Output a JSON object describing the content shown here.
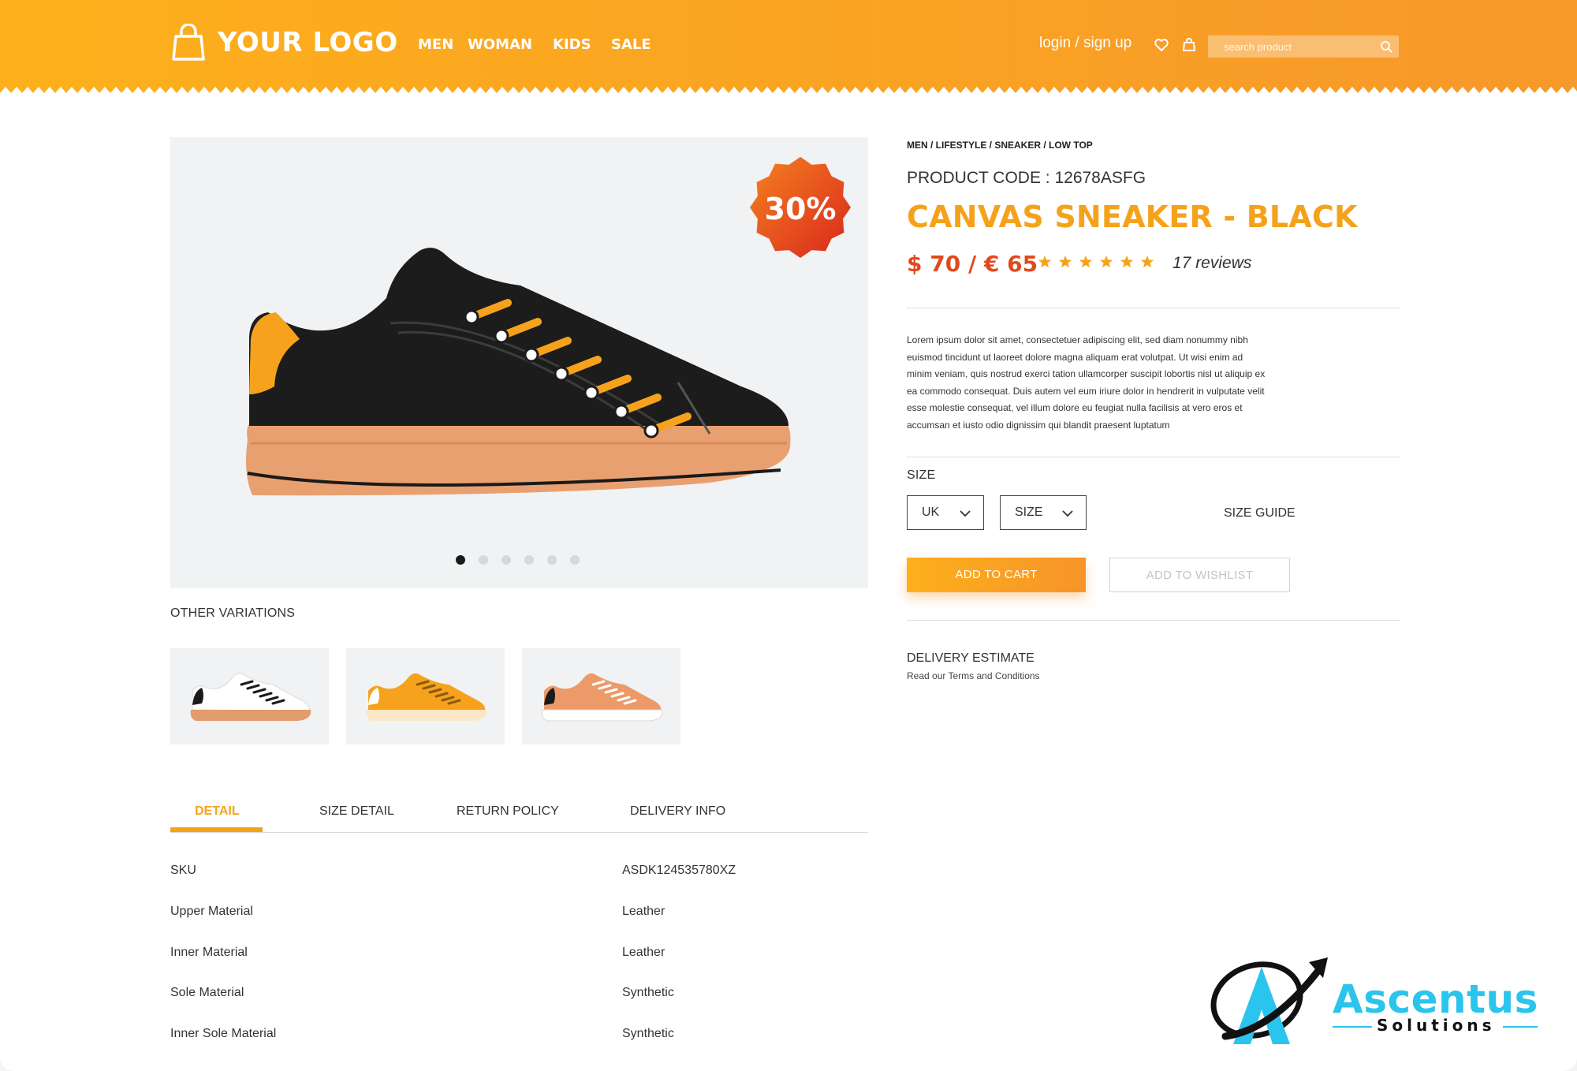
{
  "header": {
    "logo_text": "YOUR LOGO",
    "nav": [
      "MEN",
      "WOMAN",
      "KIDS",
      "SALE"
    ],
    "login": "login / sign up",
    "search_placeholder": "search product"
  },
  "gallery": {
    "discount": "30%",
    "slide_count": 6,
    "active_slide": 1
  },
  "variations": {
    "label": "OTHER VARIATIONS",
    "items": [
      "white",
      "orange",
      "peach"
    ]
  },
  "product": {
    "breadcrumb": "MEN / LIFESTYLE / SNEAKER / LOW TOP",
    "code": "PRODUCT CODE : 12678ASFG",
    "title": "CANVAS SNEAKER - BLACK",
    "price": "$ 70 / € 65",
    "rating": 6,
    "reviews": "17 reviews",
    "description": "Lorem ipsum dolor sit amet, consectetuer adipiscing elit, sed diam nonummy nibh euismod tincidunt ut laoreet dolore magna aliquam erat volutpat. Ut wisi enim ad minim veniam, quis nostrud exerci tation ullamcorper suscipit lobortis nisl ut aliquip ex ea commodo consequat. Duis autem vel eum iriure dolor in hendrerit in vulputate velit esse molestie consequat, vel illum dolore eu feugiat nulla facilisis at vero eros et accumsan et iusto odio dignissim qui blandit praesent luptatum"
  },
  "size": {
    "label": "SIZE",
    "region_select": "UK",
    "size_select": "SIZE",
    "guide": "SIZE GUIDE"
  },
  "actions": {
    "add_to_cart": "ADD TO CART",
    "add_to_wishlist": "ADD TO WISHLIST"
  },
  "delivery": {
    "title": "DELIVERY ESTIMATE",
    "subtitle": "Read our Terms and Conditions"
  },
  "tabs": {
    "items": [
      "DETAIL",
      "SIZE DETAIL",
      "RETURN POLICY",
      "DELIVERY INFO"
    ],
    "active": "DETAIL"
  },
  "specs": [
    {
      "label": "SKU",
      "value": "ASDK124535780XZ"
    },
    {
      "label": "Upper Material",
      "value": "Leather"
    },
    {
      "label": "Inner Material",
      "value": "Leather"
    },
    {
      "label": "Sole Material",
      "value": "Synthetic"
    },
    {
      "label": "Inner Sole Material",
      "value": "Synthetic"
    }
  ],
  "watermark": {
    "name": "Ascentus",
    "sub": "Solutions"
  },
  "colors": {
    "brand_orange": "#f5a21b",
    "price_red": "#e04a1f",
    "badge_red": "#e8391c",
    "watermark_cyan": "#2bc4ec"
  },
  "icons": [
    "shopping-bag-icon",
    "heart-icon",
    "bag-icon",
    "search-icon",
    "chevron-down-icon",
    "star-icon"
  ]
}
